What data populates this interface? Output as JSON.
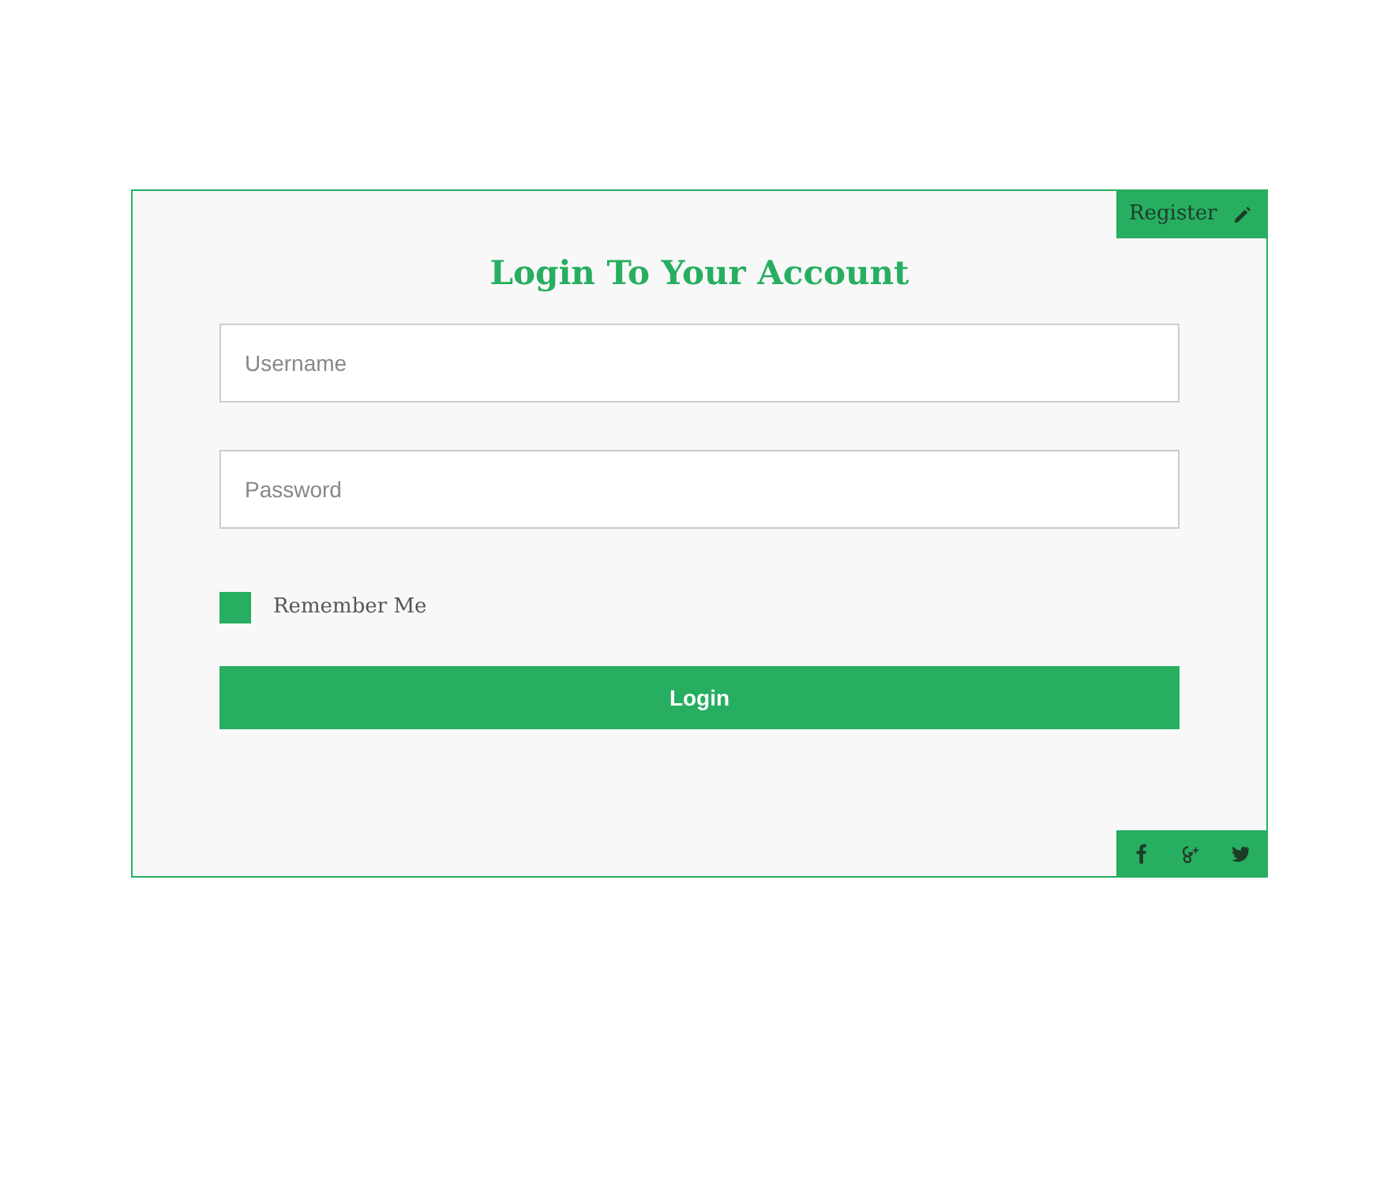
{
  "register_tab": {
    "label": "Register"
  },
  "title": "Login To Your Account",
  "fields": [
    {
      "placeholder": "Username"
    },
    {
      "placeholder": "Password"
    }
  ],
  "remember": {
    "label": "Remember Me",
    "checked": false
  },
  "login_button": {
    "label": "Login"
  },
  "social": [
    {
      "kind": "facebook"
    },
    {
      "kind": "google-plus"
    },
    {
      "kind": "twitter"
    }
  ]
}
